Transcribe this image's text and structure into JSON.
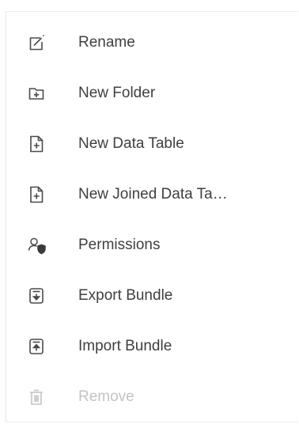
{
  "menu": {
    "items": [
      {
        "label": "Rename",
        "icon": "rename-icon",
        "disabled": false
      },
      {
        "label": "New Folder",
        "icon": "new-folder-icon",
        "disabled": false
      },
      {
        "label": "New Data Table",
        "icon": "new-file-icon",
        "disabled": false
      },
      {
        "label": "New Joined Data Ta…",
        "icon": "new-file-icon",
        "disabled": false
      },
      {
        "label": "Permissions",
        "icon": "user-shield-icon",
        "disabled": false
      },
      {
        "label": "Export Bundle",
        "icon": "archive-down-icon",
        "disabled": false
      },
      {
        "label": "Import Bundle",
        "icon": "archive-up-icon",
        "disabled": false
      },
      {
        "label": "Remove",
        "icon": "trash-icon",
        "disabled": true
      }
    ]
  },
  "colors": {
    "text": "#3f3f3f",
    "icon": "#4a4a4a",
    "disabled": "#c3c3c3"
  }
}
